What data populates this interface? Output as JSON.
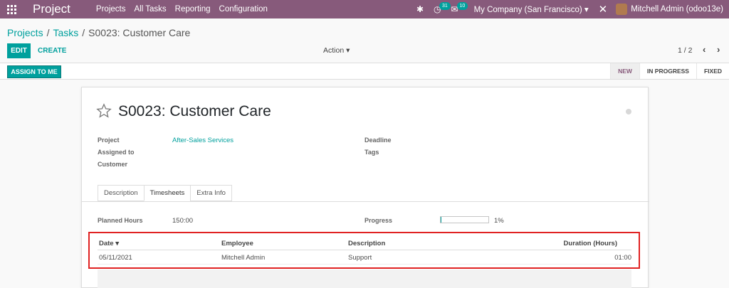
{
  "navbar": {
    "app_title": "Project",
    "menu": [
      "Projects",
      "All Tasks",
      "Reporting",
      "Configuration"
    ],
    "activity_count": "31",
    "messages_count": "10",
    "company": "My Company (San Francisco)",
    "user": "Mitchell Admin (odoo13e)"
  },
  "breadcrumb": {
    "root": "Projects",
    "parent": "Tasks",
    "current": "S0023: Customer Care"
  },
  "control": {
    "edit": "EDIT",
    "create": "CREATE",
    "action": "Action",
    "pager": "1 / 2"
  },
  "statusbar": {
    "assign": "ASSIGN TO ME",
    "stages": [
      "NEW",
      "IN PROGRESS",
      "FIXED"
    ],
    "active_stage": "NEW"
  },
  "form": {
    "title": "S0023: Customer Care",
    "project_label": "Project",
    "project_value": "After-Sales Services",
    "assigned_label": "Assigned to",
    "customer_label": "Customer",
    "deadline_label": "Deadline",
    "tags_label": "Tags",
    "tabs": [
      "Description",
      "Timesheets",
      "Extra Info"
    ],
    "active_tab": "Timesheets",
    "planned_hours_label": "Planned Hours",
    "planned_hours_value": "150:00",
    "progress_label": "Progress",
    "progress_value": "1%",
    "progress_fraction": 0.01
  },
  "timesheets": {
    "columns": {
      "date": "Date",
      "employee": "Employee",
      "description": "Description",
      "duration": "Duration (Hours)"
    },
    "rows": [
      {
        "date": "05/11/2021",
        "employee": "Mitchell Admin",
        "description": "Support",
        "duration": "01:00"
      }
    ]
  },
  "colors": {
    "brand": "#875a7b",
    "accent": "#00a09d",
    "highlight": "#e02222"
  }
}
